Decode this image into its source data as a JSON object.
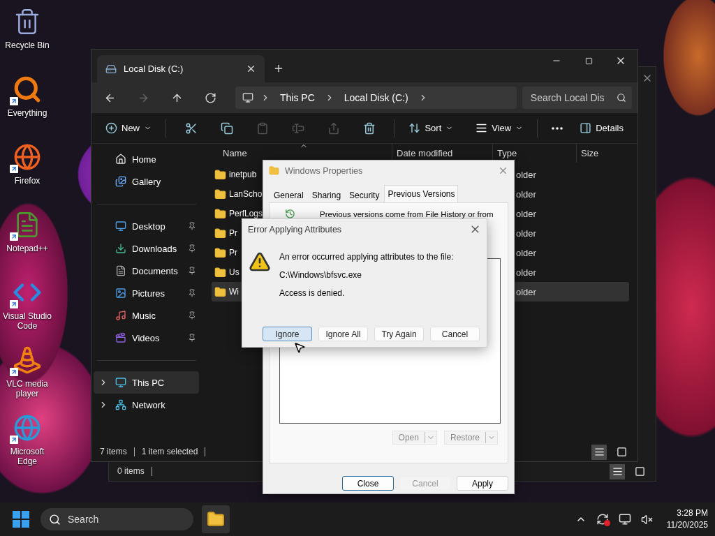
{
  "desktop_icons": [
    {
      "label": "Recycle Bin",
      "shortcut": false
    },
    {
      "label": "Everything",
      "shortcut": true
    },
    {
      "label": "Firefox",
      "shortcut": true
    },
    {
      "label": "Notepad++",
      "shortcut": true
    },
    {
      "label": "Visual Studio Code",
      "shortcut": true
    },
    {
      "label": "VLC media player",
      "shortcut": true
    },
    {
      "label": "Microsoft Edge",
      "shortcut": true
    }
  ],
  "back_window": {
    "status": "0 items",
    "views": [
      {
        "selected": true
      },
      {
        "selected": false
      }
    ]
  },
  "explorer": {
    "tabs": [
      {
        "label": "Local Disk (C:)",
        "selected": true
      }
    ],
    "nav": [
      {
        "disabled": false
      },
      {
        "disabled": true
      },
      {
        "disabled": false
      },
      {
        "disabled": false
      }
    ],
    "breadcrumb": [
      "This PC",
      "Local Disk (C:)"
    ],
    "search": {
      "placeholder": "Search Local Dis"
    },
    "toolbar": {
      "new": "New",
      "actions": [
        {
          "disabled": false
        },
        {
          "disabled": false
        },
        {
          "disabled": true
        },
        {
          "disabled": true
        },
        {
          "disabled": true
        },
        {
          "disabled": false
        }
      ],
      "sort": "Sort",
      "view": "View",
      "details": "Details"
    },
    "sidebar": {
      "top": [
        {
          "label": "Home",
          "pinned": false
        },
        {
          "label": "Gallery",
          "pinned": false
        }
      ],
      "quick": [
        {
          "label": "Desktop",
          "pinned": true
        },
        {
          "label": "Downloads",
          "pinned": true
        },
        {
          "label": "Documents",
          "pinned": true
        },
        {
          "label": "Pictures",
          "pinned": true
        },
        {
          "label": "Music",
          "pinned": true
        },
        {
          "label": "Videos",
          "pinned": true
        }
      ],
      "places": [
        {
          "label": "This PC",
          "expanded": false,
          "selected": true
        },
        {
          "label": "Network",
          "expanded": false,
          "selected": false
        }
      ]
    },
    "columns": [
      "Name",
      "Date modified",
      "Type",
      "Size"
    ],
    "rows": [
      {
        "name": "inetpub",
        "type": "older",
        "selected": false
      },
      {
        "name": "LanScho",
        "type": "older",
        "selected": false
      },
      {
        "name": "PerfLogs",
        "type": "older",
        "selected": false
      },
      {
        "name": "Pr",
        "type": "older",
        "selected": false
      },
      {
        "name": "Pr",
        "type": "older",
        "selected": false
      },
      {
        "name": "Us",
        "type": "older",
        "selected": false
      },
      {
        "name": "Wi",
        "type": "older",
        "selected": true
      }
    ],
    "status": {
      "count": "7 items",
      "selection": "1 item selected"
    },
    "views": [
      {
        "selected": true
      },
      {
        "selected": false
      }
    ]
  },
  "properties": {
    "title": "Windows Properties",
    "tabs": [
      {
        "label": "General",
        "selected": false
      },
      {
        "label": "Sharing",
        "selected": false
      },
      {
        "label": "Security",
        "selected": false
      },
      {
        "label": "Previous Versions",
        "selected": true
      }
    ],
    "intro": "Previous versions come from File History or from",
    "split_buttons": [
      {
        "label": "Open",
        "disabled": true
      },
      {
        "label": "Restore",
        "disabled": true
      }
    ],
    "buttons": [
      {
        "label": "Close",
        "disabled": false,
        "focused": true
      },
      {
        "label": "Cancel",
        "disabled": true,
        "focused": false
      },
      {
        "label": "Apply",
        "disabled": false,
        "focused": false
      }
    ]
  },
  "error": {
    "title": "Error Applying Attributes",
    "message": "An error occurred applying attributes to the file:",
    "path": "C:\\Windows\\bfsvc.exe",
    "reason": "Access is denied.",
    "buttons": [
      {
        "label": "Ignore",
        "focused": true
      },
      {
        "label": "Ignore All",
        "focused": false
      },
      {
        "label": "Try Again",
        "focused": false
      },
      {
        "label": "Cancel",
        "focused": false
      }
    ]
  },
  "taskbar": {
    "search_placeholder": "Search",
    "time": "3:28 PM",
    "date": "11/20/2025"
  }
}
